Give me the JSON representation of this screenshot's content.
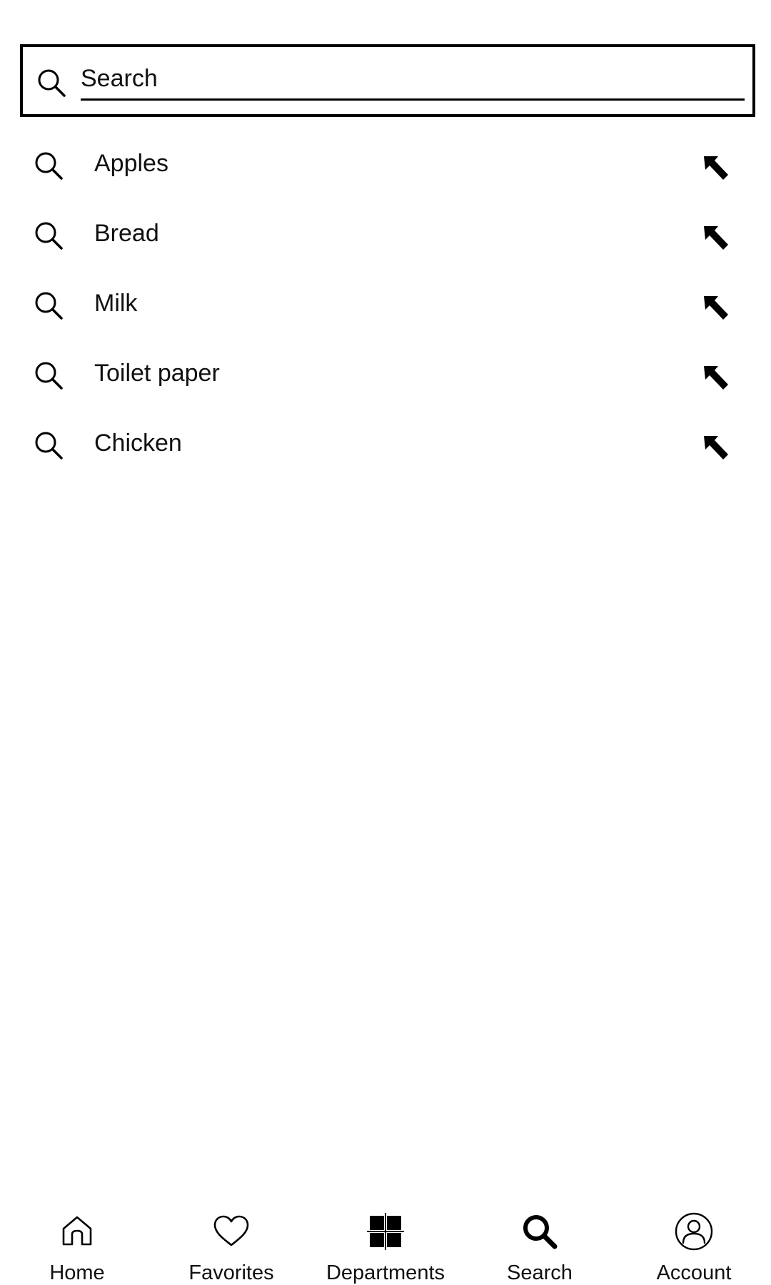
{
  "search": {
    "placeholder": "Search",
    "value": "",
    "icon": "search-icon"
  },
  "suggestions": [
    {
      "label": "Apples",
      "icon": "search-icon",
      "action_icon": "arrow-up-left-icon"
    },
    {
      "label": "Bread",
      "icon": "search-icon",
      "action_icon": "arrow-up-left-icon"
    },
    {
      "label": "Milk",
      "icon": "search-icon",
      "action_icon": "arrow-up-left-icon"
    },
    {
      "label": "Toilet paper",
      "icon": "search-icon",
      "action_icon": "arrow-up-left-icon"
    },
    {
      "label": "Chicken",
      "icon": "search-icon",
      "action_icon": "arrow-up-left-icon"
    }
  ],
  "nav": {
    "active": "search",
    "items": [
      {
        "id": "home",
        "label": "Home",
        "icon": "home-icon"
      },
      {
        "id": "favorites",
        "label": "Favorites",
        "icon": "heart-icon"
      },
      {
        "id": "departments",
        "label": "Departments",
        "icon": "grid-icon"
      },
      {
        "id": "search",
        "label": "Search",
        "icon": "search-icon"
      },
      {
        "id": "account",
        "label": "Account",
        "icon": "account-icon"
      }
    ]
  },
  "colors": {
    "text": "#111111",
    "border": "#000000",
    "background": "#ffffff"
  }
}
